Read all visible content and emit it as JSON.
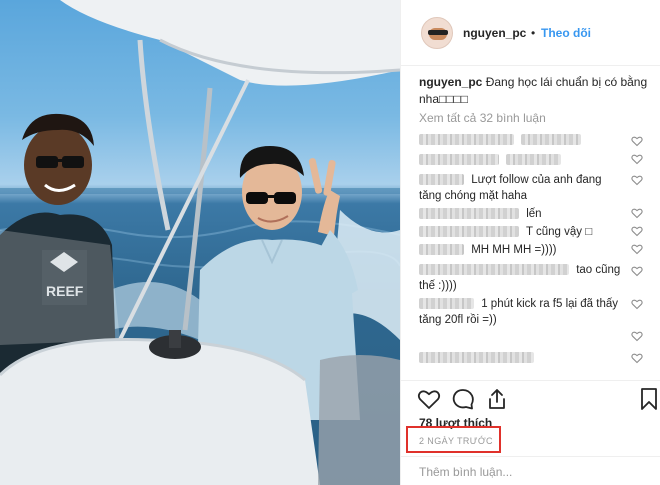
{
  "post": {
    "author": "nguyen_pc",
    "separator": "•",
    "follow_label": "Theo dõi",
    "caption_text": "Đang học lái chuẩn bị có bằng nha□□□□",
    "view_all_label": "Xem tất cả 32 bình luận",
    "likes_label": "78 lượt thích",
    "timestamp": "2 NGÀY TRƯỚC",
    "add_comment_placeholder": "Thêm bình luận..."
  },
  "comments": [
    {
      "text": ""
    },
    {
      "text": ""
    },
    {
      "text": "Lượt follow của anh đang tăng chóng mặt haha"
    },
    {
      "text": "lến"
    },
    {
      "text": "T cũng vậy □"
    },
    {
      "text": "MH MH MH =))))"
    },
    {
      "text": "tao cũng thế :))))"
    },
    {
      "text": "1 phút kick ra f5 lại đã thấy tăng 20fl rồi =))"
    },
    {
      "text": ""
    }
  ],
  "icons": {
    "heart": "heart-icon",
    "comment": "comment-icon",
    "share": "share-icon",
    "bookmark": "bookmark-icon"
  },
  "colors": {
    "link_blue": "#3897f0",
    "highlight_red": "#e0312b",
    "muted": "#999999"
  }
}
